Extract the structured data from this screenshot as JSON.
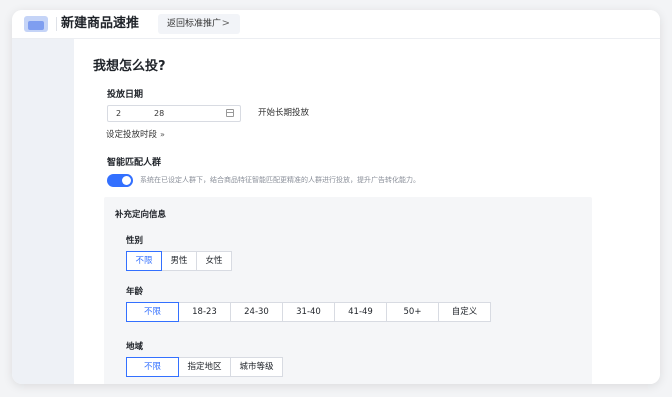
{
  "header": {
    "app_title": "新建商品速推",
    "back_label": "返回标准推广",
    "back_chevron": ">"
  },
  "section": {
    "title": "我想怎么投?"
  },
  "date": {
    "label": "投放日期",
    "start": "2",
    "end": "28",
    "long_term_label": "开始长期投放",
    "set_period_label": "设定投放时段",
    "set_period_chevron": "»"
  },
  "smart": {
    "label": "智能匹配人群",
    "toggle_on": true,
    "description": "系统在已设定人群下，结合商品特征智能匹配更精准的人群进行投放，提升广告转化能力。"
  },
  "targeting": {
    "title": "补充定向信息",
    "gender": {
      "label": "性别",
      "options": [
        "不限",
        "男性",
        "女性"
      ],
      "selected": "不限"
    },
    "age": {
      "label": "年龄",
      "options": [
        "不限",
        "18-23",
        "24-30",
        "31-40",
        "41-49",
        "50+",
        "自定义"
      ],
      "selected": "不限"
    },
    "region": {
      "label": "地域",
      "options": [
        "不限",
        "指定地区",
        "城市等级"
      ],
      "selected": "不限"
    }
  },
  "colors": {
    "accent": "#3370ff",
    "sidebar": "#eef1f6",
    "card_bg": "#f5f6f8"
  }
}
